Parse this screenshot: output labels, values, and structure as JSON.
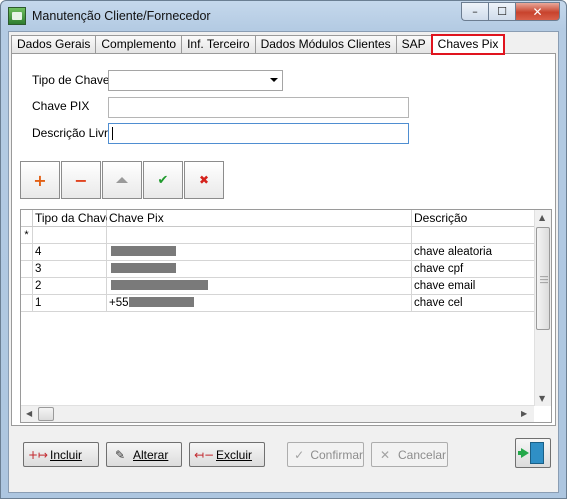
{
  "window": {
    "title": "Manutenção Cliente/Fornecedor",
    "controls": {
      "minimize": "–",
      "maximize": "☐",
      "close": "✕"
    }
  },
  "tabs": [
    {
      "label": "Dados Gerais",
      "active": false
    },
    {
      "label": "Complemento",
      "active": false
    },
    {
      "label": "Inf. Terceiro",
      "active": false
    },
    {
      "label": "Dados Módulos Clientes",
      "active": false
    },
    {
      "label": "SAP",
      "active": false
    },
    {
      "label": "Chaves Pix",
      "active": true
    }
  ],
  "form": {
    "tipo_label": "Tipo de Chave",
    "tipo_value": "",
    "chave_label": "Chave PIX",
    "chave_value": "",
    "descricao_label": "Descrição Livre",
    "descricao_value": ""
  },
  "navigator": {
    "buttons": [
      {
        "name": "insert-record-button",
        "icon": "plus-icon",
        "glyph": "+",
        "enabled": true
      },
      {
        "name": "delete-record-button",
        "icon": "minus-icon",
        "glyph": "−",
        "enabled": true
      },
      {
        "name": "edit-record-button",
        "icon": "triangle-up-icon",
        "glyph": "",
        "enabled": true
      },
      {
        "name": "post-record-button",
        "icon": "check-icon",
        "glyph": "✔",
        "enabled": true
      },
      {
        "name": "cancel-record-button",
        "icon": "cross-icon",
        "glyph": "✖",
        "enabled": true
      }
    ]
  },
  "grid": {
    "columns": [
      "Tipo da Chave",
      "Chave Pix",
      "Descrição"
    ],
    "new_row_marker": "*",
    "rows": [
      {
        "tipo": "4",
        "chave_prefix": "",
        "redacted": true,
        "descricao": "chave aleatoria"
      },
      {
        "tipo": "3",
        "chave_prefix": "",
        "redacted": true,
        "descricao": "chave cpf"
      },
      {
        "tipo": "2",
        "chave_prefix": "",
        "redacted": true,
        "descricao": "chave email"
      },
      {
        "tipo": "1",
        "chave_prefix": "+55",
        "redacted": true,
        "descricao": "chave cel"
      }
    ]
  },
  "footer": {
    "incluir": "Incluir",
    "alterar": "Alterar",
    "excluir": "Excluir",
    "confirmar": "Confirmar",
    "cancelar": "Cancelar"
  },
  "colors": {
    "active_tab_border": "#e0141e",
    "plus": "#e26015",
    "check": "#1f9a2c",
    "cross": "#d5221c",
    "redaction": "#7a7a7a"
  }
}
